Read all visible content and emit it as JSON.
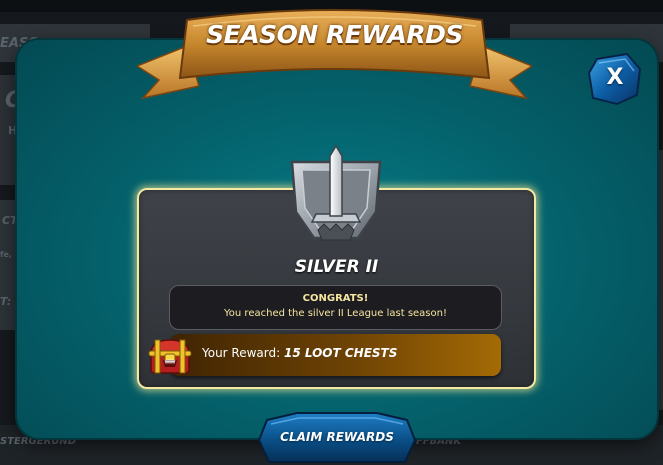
{
  "modal": {
    "title": "SEASON REWARDS",
    "close_label": "X",
    "league_name": "SILVER II",
    "league_icon": "silver-league-sword-shield-icon",
    "congrats_title": "CONGRATS!",
    "congrats_message": "You reached the silver II League last season!",
    "reward_label": "Your Reward:",
    "reward_value": "15 LOOT CHESTS",
    "reward_icon": "loot-chest-icon",
    "claim_label": "CLAIM REWARDS"
  },
  "background": {
    "left_top_label": "EASO",
    "left_mid_letter": "C",
    "left_mid_letter2": "H",
    "left_label_ct": "CT",
    "left_label_fe": "fe,",
    "left_label_t": "T:",
    "bottom_left_label": "STERGERUND",
    "bottom_right_label": "FFBANK"
  },
  "colors": {
    "modal_teal": "#067d88",
    "panel_border": "#f3e9a3",
    "banner_gold": "#c6872d",
    "congrats_text": "#f5e6a0",
    "reward_bar_gold": "#a46a05",
    "button_blue": "#0a4f86"
  }
}
